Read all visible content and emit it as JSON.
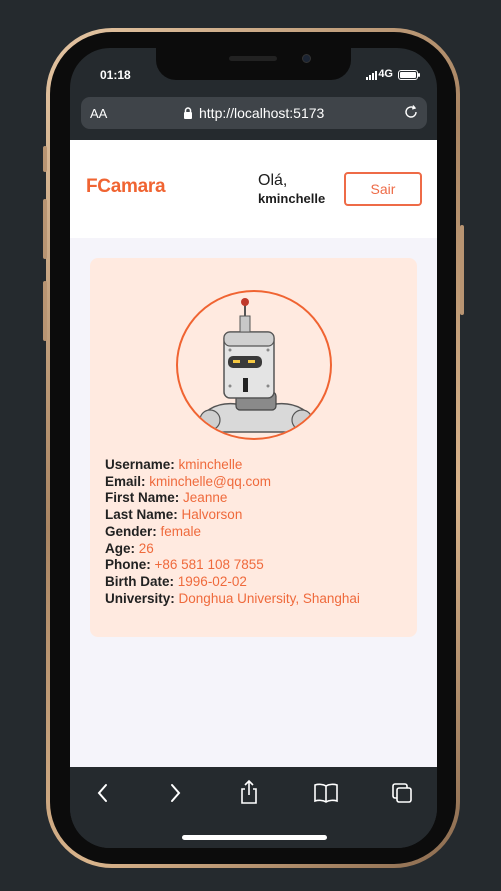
{
  "status": {
    "time": "01:18",
    "network": "4G"
  },
  "browser": {
    "aa_label": "AA",
    "url": "http://localhost:5173"
  },
  "header": {
    "brand": "FCamara",
    "greeting": "Olá,",
    "username": "kminchelle",
    "logout_label": "Sair"
  },
  "profile": {
    "avatar_icon": "robot-avatar",
    "fields": [
      {
        "label": "Username:",
        "value": "kminchelle"
      },
      {
        "label": "Email:",
        "value": "kminchelle@qq.com"
      },
      {
        "label": "First Name:",
        "value": "Jeanne"
      },
      {
        "label": "Last Name:",
        "value": "Halvorson"
      },
      {
        "label": "Gender:",
        "value": "female"
      },
      {
        "label": "Age:",
        "value": "26"
      },
      {
        "label": "Phone:",
        "value": "+86 581 108 7855"
      },
      {
        "label": "Birth Date:",
        "value": "1996-02-02"
      },
      {
        "label": "University:",
        "value": "Donghua University, Shanghai"
      }
    ]
  },
  "toolbar": {
    "icons": [
      "back-icon",
      "forward-icon",
      "share-icon",
      "bookmarks-icon",
      "tabs-icon"
    ]
  },
  "colors": {
    "accent": "#f06432",
    "card_bg": "#ffeae0",
    "page_bg": "#f5f4fa",
    "frame_bg": "#252a2e"
  }
}
